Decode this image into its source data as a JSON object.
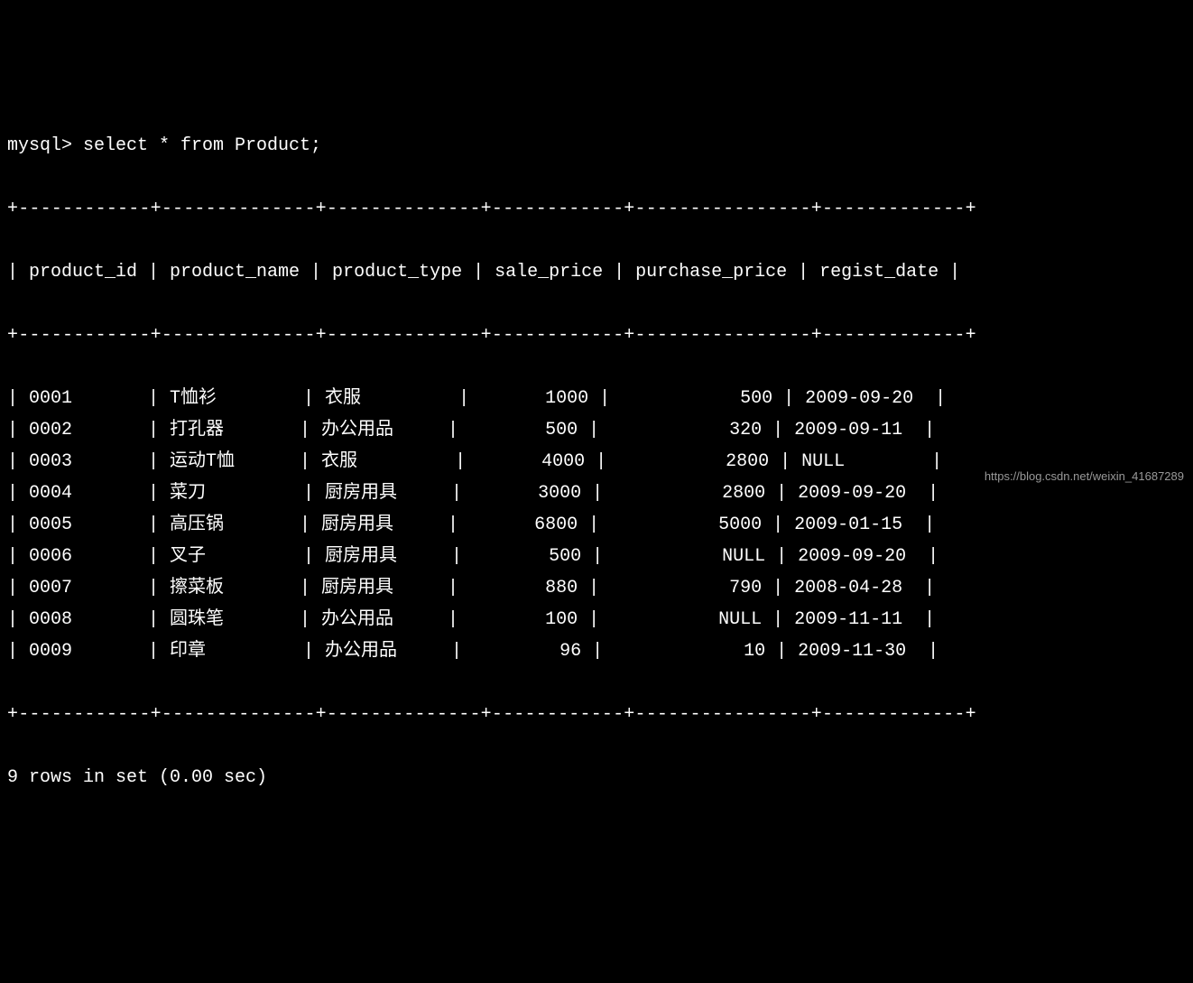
{
  "prompt": "mysql> select * from Product;",
  "border": "+------------+--------------+--------------+------------+----------------+-------------+",
  "columns": [
    "product_id",
    "product_name",
    "product_type",
    "sale_price",
    "purchase_price",
    "regist_date"
  ],
  "rows": [
    {
      "product_id": "0001",
      "product_name": "T恤衫",
      "product_type": "衣服",
      "sale_price": "1000",
      "purchase_price": "500",
      "regist_date": "2009-09-20"
    },
    {
      "product_id": "0002",
      "product_name": "打孔器",
      "product_type": "办公用品",
      "sale_price": "500",
      "purchase_price": "320",
      "regist_date": "2009-09-11"
    },
    {
      "product_id": "0003",
      "product_name": "运动T恤",
      "product_type": "衣服",
      "sale_price": "4000",
      "purchase_price": "2800",
      "regist_date": "NULL"
    },
    {
      "product_id": "0004",
      "product_name": "菜刀",
      "product_type": "厨房用具",
      "sale_price": "3000",
      "purchase_price": "2800",
      "regist_date": "2009-09-20"
    },
    {
      "product_id": "0005",
      "product_name": "高压锅",
      "product_type": "厨房用具",
      "sale_price": "6800",
      "purchase_price": "5000",
      "regist_date": "2009-01-15"
    },
    {
      "product_id": "0006",
      "product_name": "叉子",
      "product_type": "厨房用具",
      "sale_price": "500",
      "purchase_price": "NULL",
      "regist_date": "2009-09-20"
    },
    {
      "product_id": "0007",
      "product_name": "擦菜板",
      "product_type": "厨房用具",
      "sale_price": "880",
      "purchase_price": "790",
      "regist_date": "2008-04-28"
    },
    {
      "product_id": "0008",
      "product_name": "圆珠笔",
      "product_type": "办公用品",
      "sale_price": "100",
      "purchase_price": "NULL",
      "regist_date": "2009-11-11"
    },
    {
      "product_id": "0009",
      "product_name": "印章",
      "product_type": "办公用品",
      "sale_price": "96",
      "purchase_price": "10",
      "regist_date": "2009-11-30"
    }
  ],
  "footer": "9 rows in set (0.00 sec)",
  "watermark": "https://blog.csdn.net/weixin_41687289"
}
